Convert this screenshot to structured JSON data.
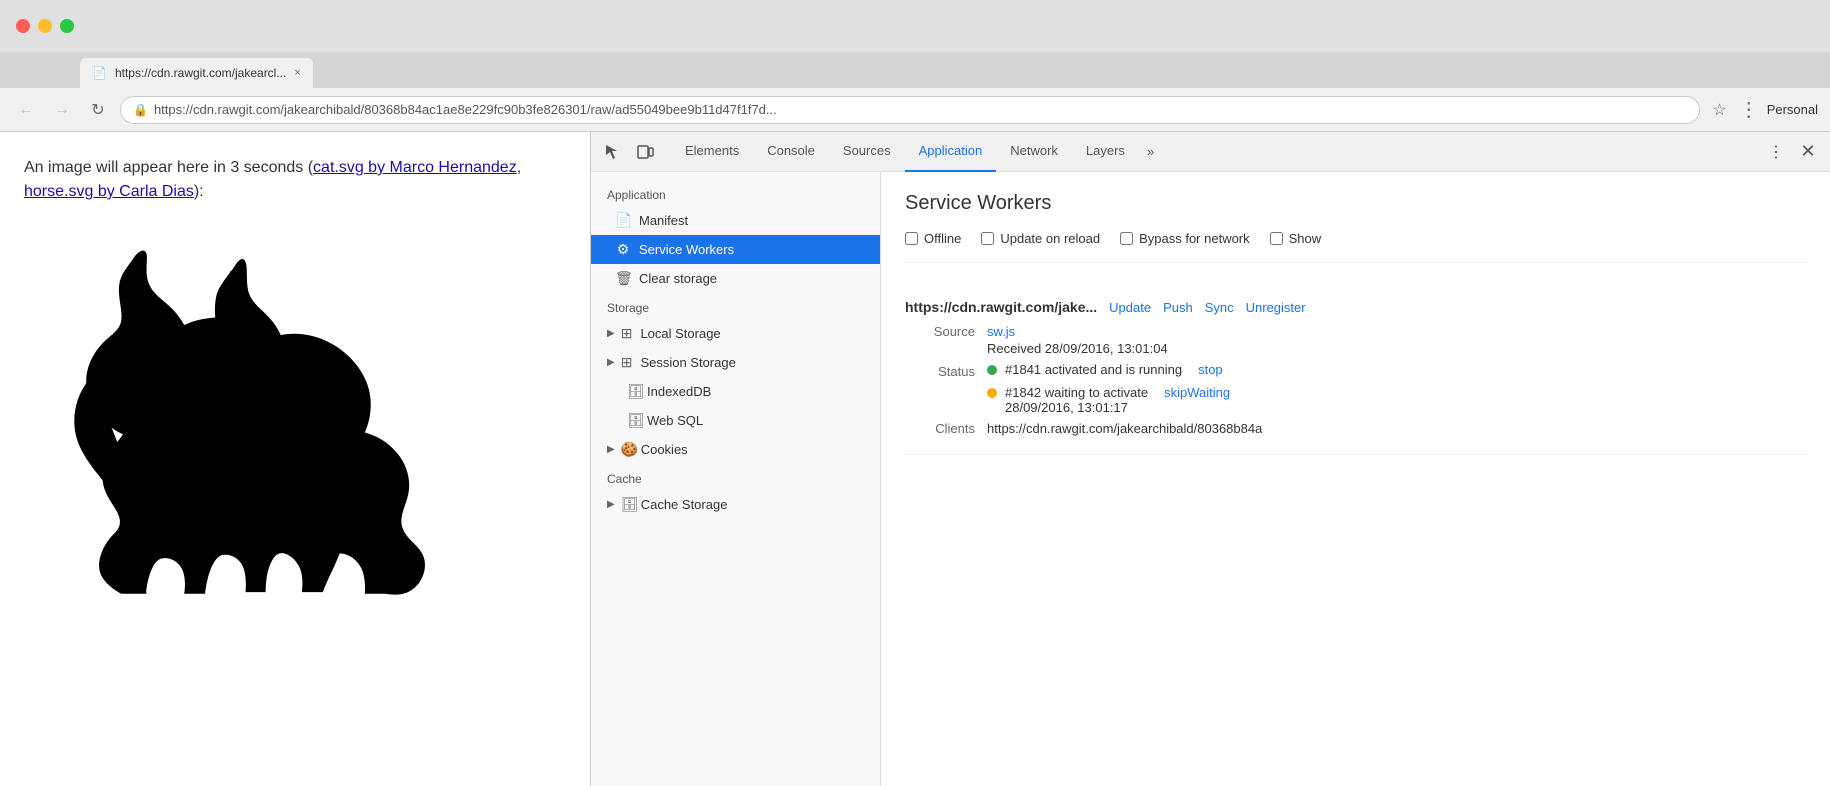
{
  "browser": {
    "profile": "Personal",
    "tab": {
      "title": "https://cdn.rawgit.com/jakearcl...",
      "url_display": "https://cdn.rawgit.com/jakearchibald/80368b84ac1ae8e229fc90b3fe826301/raw/ad55049bee9b11d47f1f7d...",
      "url_full": "https://cdn.rawgit.com/jakearchibald/80368b84ac1ae8e229fc90b3fe826301/raw/ad55049bee9b11d47f1f7d...",
      "close_label": "×"
    },
    "nav": {
      "back": "←",
      "forward": "→",
      "refresh": "↻"
    }
  },
  "page": {
    "text_before": "An image will appear here in 3 seconds (",
    "link1_text": "cat.svg by Marco Hernandez",
    "link1_href": "#",
    "comma": ", ",
    "link2_text": "horse.svg by Carla Dias",
    "link2_href": "#",
    "text_after": "):"
  },
  "devtools": {
    "tabs": [
      {
        "id": "elements",
        "label": "Elements"
      },
      {
        "id": "console",
        "label": "Console"
      },
      {
        "id": "sources",
        "label": "Sources"
      },
      {
        "id": "application",
        "label": "Application"
      },
      {
        "id": "network",
        "label": "Network"
      },
      {
        "id": "layers",
        "label": "Layers"
      }
    ],
    "active_tab": "application",
    "more_label": "»",
    "sidebar": {
      "sections": [
        {
          "title": "Application",
          "items": [
            {
              "id": "manifest",
              "label": "Manifest",
              "icon": "📄",
              "type": "item"
            },
            {
              "id": "service-workers",
              "label": "Service Workers",
              "icon": "⚙",
              "type": "item",
              "active": true
            },
            {
              "id": "clear-storage",
              "label": "Clear storage",
              "icon": "🗑",
              "type": "item"
            }
          ]
        },
        {
          "title": "Storage",
          "items": [
            {
              "id": "local-storage",
              "label": "Local Storage",
              "icon": "▶",
              "type": "arrow"
            },
            {
              "id": "session-storage",
              "label": "Session Storage",
              "icon": "▶",
              "type": "arrow"
            },
            {
              "id": "indexed-db",
              "label": "IndexedDB",
              "icon": "🗄",
              "type": "item-plain"
            },
            {
              "id": "web-sql",
              "label": "Web SQL",
              "icon": "🗄",
              "type": "item-plain"
            },
            {
              "id": "cookies",
              "label": "Cookies",
              "icon": "▶",
              "type": "arrow-cookie"
            }
          ]
        },
        {
          "title": "Cache",
          "items": [
            {
              "id": "cache-storage",
              "label": "Cache Storage",
              "icon": "▶",
              "type": "arrow"
            }
          ]
        }
      ]
    },
    "panel": {
      "title": "Service Workers",
      "checkboxes": [
        {
          "id": "offline",
          "label": "Offline"
        },
        {
          "id": "update-on-reload",
          "label": "Update on reload"
        },
        {
          "id": "bypass-for-network",
          "label": "Bypass for network"
        },
        {
          "id": "show",
          "label": "Show"
        }
      ],
      "sw_entry": {
        "url": "https://cdn.rawgit.com/jake...",
        "actions": [
          "Update",
          "Push",
          "Sync",
          "Unregister"
        ],
        "source_label": "Source",
        "source_link": "sw.js",
        "received": "Received 28/09/2016, 13:01:04",
        "status_label": "Status",
        "statuses": [
          {
            "dot": "green",
            "text": "#1841 activated and is running",
            "action": "stop"
          },
          {
            "dot": "orange",
            "text": "#1842 waiting to activate",
            "action": "skipWaiting",
            "subtext": "28/09/2016, 13:01:17"
          }
        ],
        "clients_label": "Clients",
        "clients_value": "https://cdn.rawgit.com/jakearchibald/80368b84a"
      }
    }
  }
}
